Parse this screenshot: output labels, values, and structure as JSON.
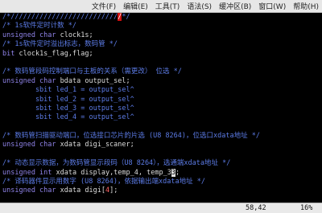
{
  "menu": [
    "文件(F)",
    "编辑(E)",
    "工具(T)",
    "语法(S)",
    "缓冲区(B)",
    "窗口(W)",
    "帮助(H)"
  ],
  "code": {
    "l1": "/*//////////////////////////",
    "l1_hl": "/",
    "l1_tail": "*/",
    "l2": "/* 1s软件定时计数 */",
    "l3a": "unsigned char",
    "l3b": " clock1s;",
    "l4": "/* 1s软件定时溢出标志，数码管 */",
    "l5a": "bit",
    "l5b": " clock1s_flag,flag;",
    "l7": "/* 数码管段码控制端口与主板的关系（需更改） 位选 */",
    "l8a": "unsigned char",
    "l8b": " bdata output_sel;",
    "l9": "        sbit led_1 = output_sel^",
    "l10": "        sbit led_2 = output_sel^",
    "l11": "        sbit led_3 = output_sel^",
    "l12": "        sbit led_4 = output_sel^",
    "l14": "/* 数码管扫描驱动端口，位选接口芯片的片选 (U8 8264)，位选口xdata地址 */",
    "l15a": "unsigned char",
    "l15b": " xdata digi_scaner;",
    "l17": "/* 动态显示数据，为数码管显示段码（U8 8264），选通端xdata地址 */",
    "l18a": "unsigned int",
    "l18b": " xdata display,temp_4, temp_3",
    "l18_cursor": "3",
    "l18_tail": ";",
    "l19": "/* 译码器件显示用数字 (U8 8264)，依据输出端xdata地址 */",
    "l20a": "unsigned char",
    "l20b": " xdata digi[",
    "l20n": "4",
    "l20c": "];",
    "l22": "/*//////////////////////////////////////////////////////////////////*/"
  },
  "status": {
    "position": "58,42",
    "percent": "16%"
  }
}
